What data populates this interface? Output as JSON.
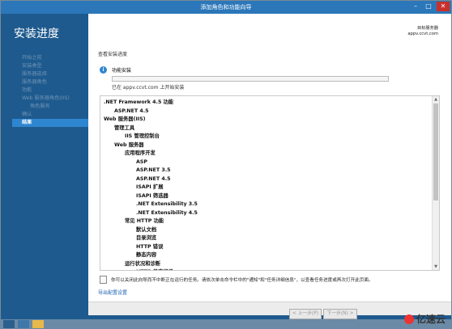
{
  "window": {
    "title": "添加角色和功能向导"
  },
  "header": {
    "heading": "安装进度",
    "target_label": "目标服务器",
    "target_server": "appv.ccvt.com"
  },
  "nav": {
    "items": [
      {
        "label": "开始之前",
        "active": false,
        "sub": false
      },
      {
        "label": "安装类型",
        "active": false,
        "sub": false
      },
      {
        "label": "服务器选择",
        "active": false,
        "sub": false
      },
      {
        "label": "服务器角色",
        "active": false,
        "sub": false
      },
      {
        "label": "功能",
        "active": false,
        "sub": false
      },
      {
        "label": "Web 服务器角色(IIS)",
        "active": false,
        "sub": false
      },
      {
        "label": "角色服务",
        "active": false,
        "sub": true
      },
      {
        "label": "确认",
        "active": false,
        "sub": false
      },
      {
        "label": "结果",
        "active": true,
        "sub": false
      }
    ]
  },
  "main": {
    "section_title": "查看安装进度",
    "feature_label": "功能安装",
    "progress_status": "已在 appv.ccvt.com 上开始安装",
    "tree": [
      {
        "label": ".NET Framework 4.5 功能",
        "level": 0
      },
      {
        "label": "ASP.NET 4.5",
        "level": 1
      },
      {
        "label": "Web 服务器(IIS)",
        "level": 0
      },
      {
        "label": "管理工具",
        "level": 1
      },
      {
        "label": "IIS 管理控制台",
        "level": 2
      },
      {
        "label": "Web 服务器",
        "level": 1
      },
      {
        "label": "应用程序开发",
        "level": 2
      },
      {
        "label": "ASP",
        "level": 3
      },
      {
        "label": "ASP.NET 3.5",
        "level": 3
      },
      {
        "label": "ASP.NET 4.5",
        "level": 3
      },
      {
        "label": "ISAPI 扩展",
        "level": 3
      },
      {
        "label": "ISAPI 筛选器",
        "level": 3
      },
      {
        "label": ".NET Extensibility 3.5",
        "level": 3
      },
      {
        "label": ".NET Extensibility 4.5",
        "level": 3
      },
      {
        "label": "常见 HTTP 功能",
        "level": 2
      },
      {
        "label": "默认文档",
        "level": 3
      },
      {
        "label": "目录浏览",
        "level": 3
      },
      {
        "label": "HTTP 错误",
        "level": 3
      },
      {
        "label": "静态内容",
        "level": 3
      },
      {
        "label": "运行状况和诊断",
        "level": 2
      },
      {
        "label": "HTTP 日志记录",
        "level": 3
      }
    ],
    "note": "你可以关闭此向导而不中断正在运行的任务。请依次单击命令栏中的\"通知\"和\"任务详细信息\"，以查看任务进度或再次打开此页面。",
    "export_link": "导出配置设置"
  },
  "footer": {
    "prev_label": "< 上一步(P)",
    "next_label": "下一步(N) >"
  },
  "watermark": {
    "text": "亿速云"
  },
  "colors": {
    "sidebar": "#1e5a8e",
    "titlebar": "#2b77b9",
    "accent": "#2f86d0"
  }
}
